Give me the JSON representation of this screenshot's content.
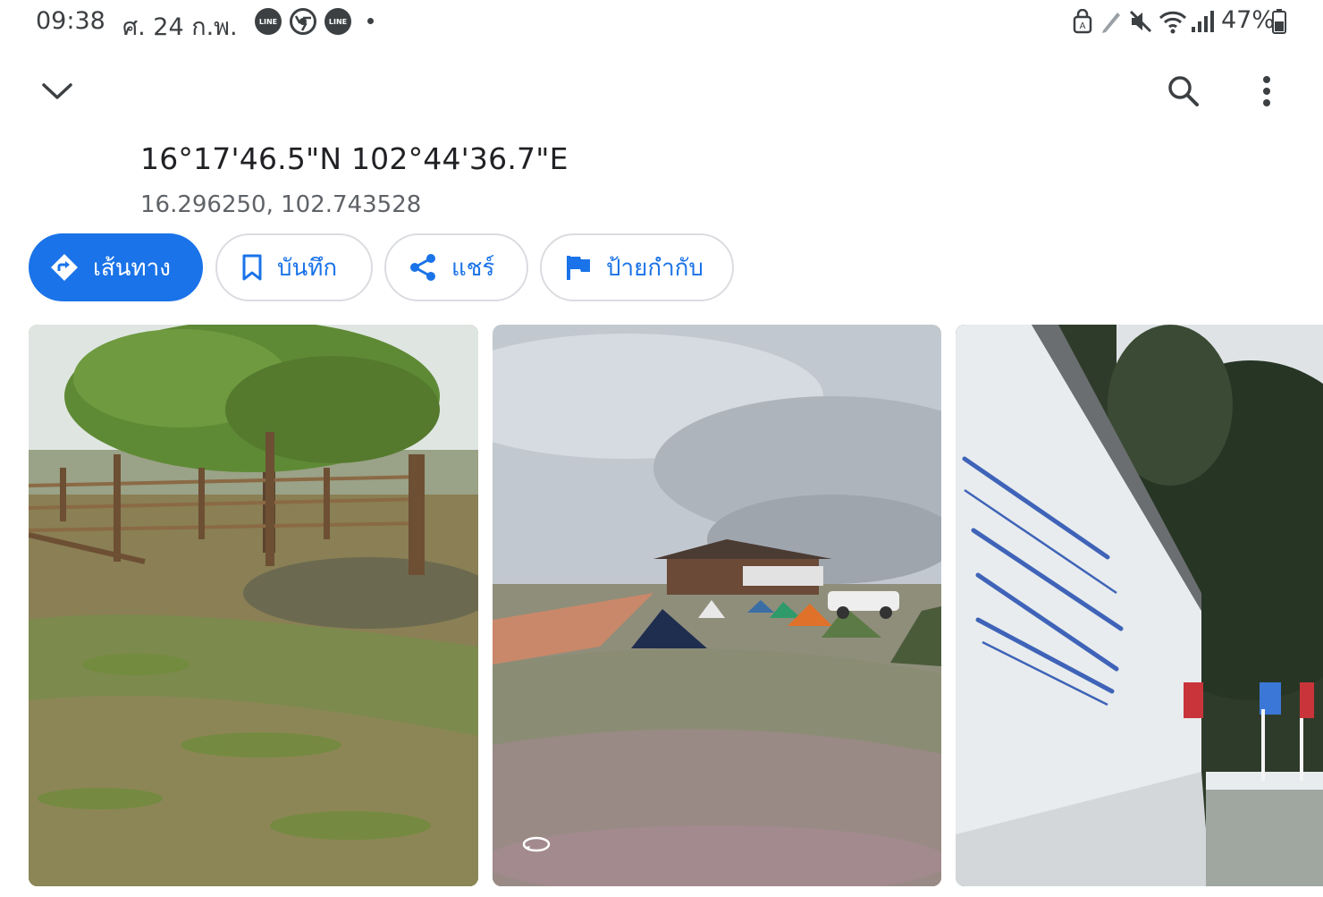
{
  "status_bar": {
    "time": "09:38",
    "date": "ศ. 24 ก.พ.",
    "notifications": [
      "LINE",
      "chrome-icon",
      "LINE"
    ],
    "battery": "47%"
  },
  "header": {
    "collapse_icon": "chevron-down-icon",
    "search_icon": "search-icon",
    "more_icon": "more-vert-icon"
  },
  "place": {
    "title": "16°17'46.5\"N 102°44'36.7\"E",
    "subtitle": "16.296250, 102.743528"
  },
  "actions": [
    {
      "label": "เส้นทาง",
      "icon": "directions-icon"
    },
    {
      "label": "บันทึก",
      "icon": "bookmark-icon"
    },
    {
      "label": "แชร์",
      "icon": "share-icon"
    },
    {
      "label": "ป้ายกำกับ",
      "icon": "flag-icon"
    }
  ],
  "photos": [
    {
      "name": "photo-field-fence"
    },
    {
      "name": "photo-campsite-panorama",
      "icon": "360-icon"
    },
    {
      "name": "photo-wall-sign"
    }
  ],
  "colors": {
    "accent": "#1a73e8",
    "text_primary": "#202124",
    "text_secondary": "#5f6368",
    "chip_border": "#dadce0"
  }
}
